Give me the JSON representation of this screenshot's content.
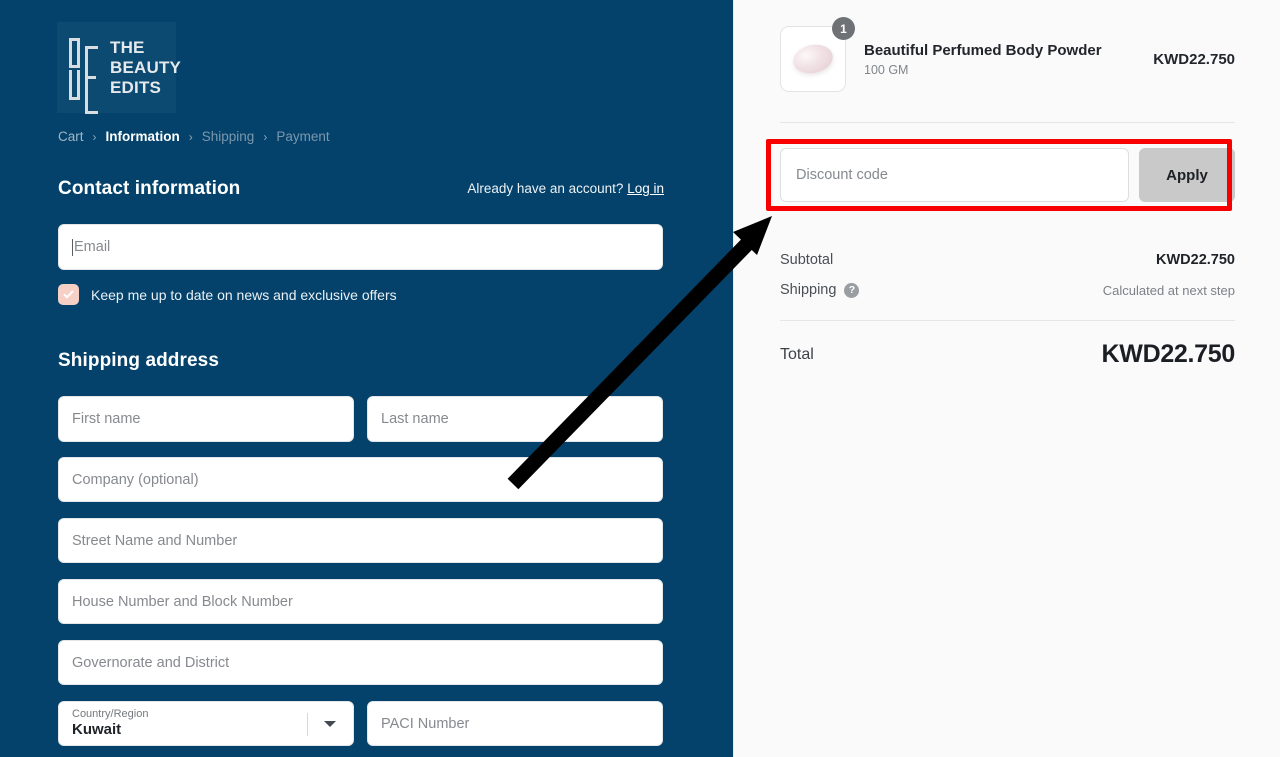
{
  "brand": {
    "logo_line1": "THE",
    "logo_line2": "BEAUTY",
    "logo_line3": "EDITS",
    "logo_alt": "The Beauty Edits"
  },
  "breadcrumb": {
    "items": [
      {
        "label": "Cart",
        "state": "done"
      },
      {
        "label": "Information",
        "state": "current"
      },
      {
        "label": "Shipping",
        "state": "upcoming"
      },
      {
        "label": "Payment",
        "state": "upcoming"
      }
    ],
    "separator": "›"
  },
  "contact": {
    "heading": "Contact information",
    "account_prompt": "Already have an account?",
    "login_label": "Log in",
    "email_placeholder": "Email",
    "email_value": "",
    "newsletter_label": "Keep me up to date on news and exclusive offers",
    "newsletter_checked": true
  },
  "shipping_address": {
    "heading": "Shipping address",
    "fields": [
      {
        "name": "first_name",
        "placeholder": "First name",
        "value": ""
      },
      {
        "name": "last_name",
        "placeholder": "Last name",
        "value": ""
      },
      {
        "name": "company",
        "placeholder": "Company (optional)",
        "value": ""
      },
      {
        "name": "street",
        "placeholder": "Street Name and Number",
        "value": ""
      },
      {
        "name": "house",
        "placeholder": "House Number and Block Number",
        "value": ""
      },
      {
        "name": "governorate",
        "placeholder": "Governorate and District",
        "value": ""
      },
      {
        "name": "paci",
        "placeholder": "PACI Number",
        "value": ""
      }
    ],
    "country": {
      "label": "Country/Region",
      "value": "Kuwait"
    }
  },
  "summary": {
    "product": {
      "title": "Beautiful Perfumed Body Powder",
      "variant": "100 GM",
      "quantity": "1",
      "price": "KWD22.750"
    },
    "discount": {
      "placeholder": "Discount code",
      "value": "",
      "apply_label": "Apply"
    },
    "lines": [
      {
        "label": "Subtotal",
        "value": "KWD22.750",
        "style": "bold"
      },
      {
        "label": "Shipping",
        "value": "Calculated at next step",
        "style": "muted",
        "has_help": true
      }
    ],
    "total": {
      "label": "Total",
      "value": "KWD22.750"
    }
  },
  "annotation": {
    "highlight_color": "#f70000",
    "arrow_color": "#000000",
    "target": "discount-code-field"
  },
  "colors": {
    "panel_blue": "#04426b",
    "summary_bg": "#fafafa",
    "checkbox_pink": "#f6cfc5",
    "apply_gray": "#c9c9c9"
  }
}
